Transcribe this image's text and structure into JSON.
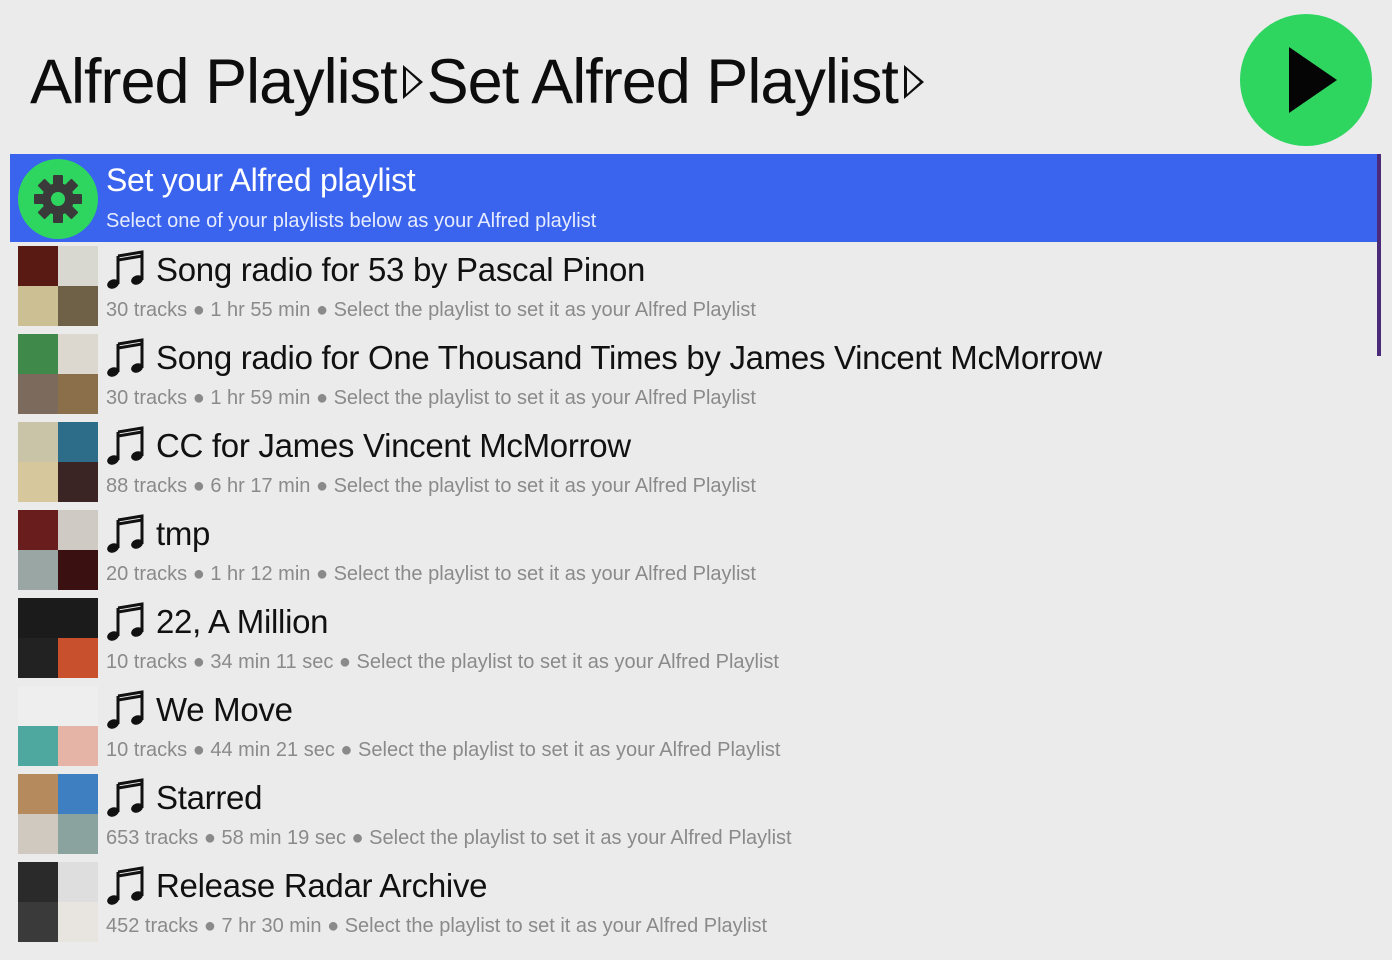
{
  "header": {
    "query_segments": [
      "Alfred Playlist",
      "Set Alfred Playlist"
    ],
    "play_button_color": "#2ed660"
  },
  "selected_item": {
    "title": "Set your Alfred playlist",
    "subtitle": "Select one of your playlists below as your Alfred playlist",
    "icon": "gear-icon",
    "highlight_color": "#3a63ee"
  },
  "playlists": [
    {
      "title": "Song radio for 53 by Pascal Pinon",
      "subtitle": "30 tracks ● 1 hr 55 min ● Select the playlist to set it as your Alfred Playlist",
      "colors": [
        "#5a1a14",
        "#d8d8d0",
        "#cdbf94",
        "#6f6148"
      ]
    },
    {
      "title": "Song radio for One Thousand Times by James Vincent McMorrow",
      "subtitle": "30 tracks ● 1 hr 59 min ● Select the playlist to set it as your Alfred Playlist",
      "colors": [
        "#3f8a4a",
        "#dcd8d0",
        "#7c6a5c",
        "#8a6f4a"
      ]
    },
    {
      "title": "CC for James Vincent McMorrow",
      "subtitle": "88 tracks ● 6 hr 17 min ● Select the playlist to set it as your Alfred Playlist",
      "colors": [
        "#c9c3a8",
        "#2d6d8a",
        "#d6c89c",
        "#3a2424"
      ]
    },
    {
      "title": "tmp",
      "subtitle": "20 tracks ● 1 hr 12 min ● Select the playlist to set it as your Alfred Playlist",
      "colors": [
        "#6a1d1d",
        "#cfcbc4",
        "#9aa6a3",
        "#3a1010"
      ]
    },
    {
      "title": "22, A Million",
      "subtitle": "10 tracks ● 34 min 11 sec ● Select the playlist to set it as your Alfred Playlist",
      "colors": [
        "#1b1b1b",
        "#1b1b1b",
        "#222222",
        "#c8502c"
      ]
    },
    {
      "title": "We Move",
      "subtitle": "10 tracks ● 44 min 21 sec ● Select the playlist to set it as your Alfred Playlist",
      "colors": [
        "#eeeeee",
        "#eeeeee",
        "#4fa8a0",
        "#e6b4a6"
      ]
    },
    {
      "title": "Starred",
      "subtitle": "653 tracks ● 58 min 19 sec ● Select the playlist to set it as your Alfred Playlist",
      "colors": [
        "#b58a5c",
        "#3d7fc0",
        "#cfc9c0",
        "#8aa39e"
      ]
    },
    {
      "title": "Release Radar Archive",
      "subtitle": "452 tracks ● 7 hr 30 min ● Select the playlist to set it as your Alfred Playlist",
      "colors": [
        "#2a2a2a",
        "#dedede",
        "#3a3a3a",
        "#e8e4e0"
      ]
    }
  ],
  "list_item_icon": "music-note-icon"
}
